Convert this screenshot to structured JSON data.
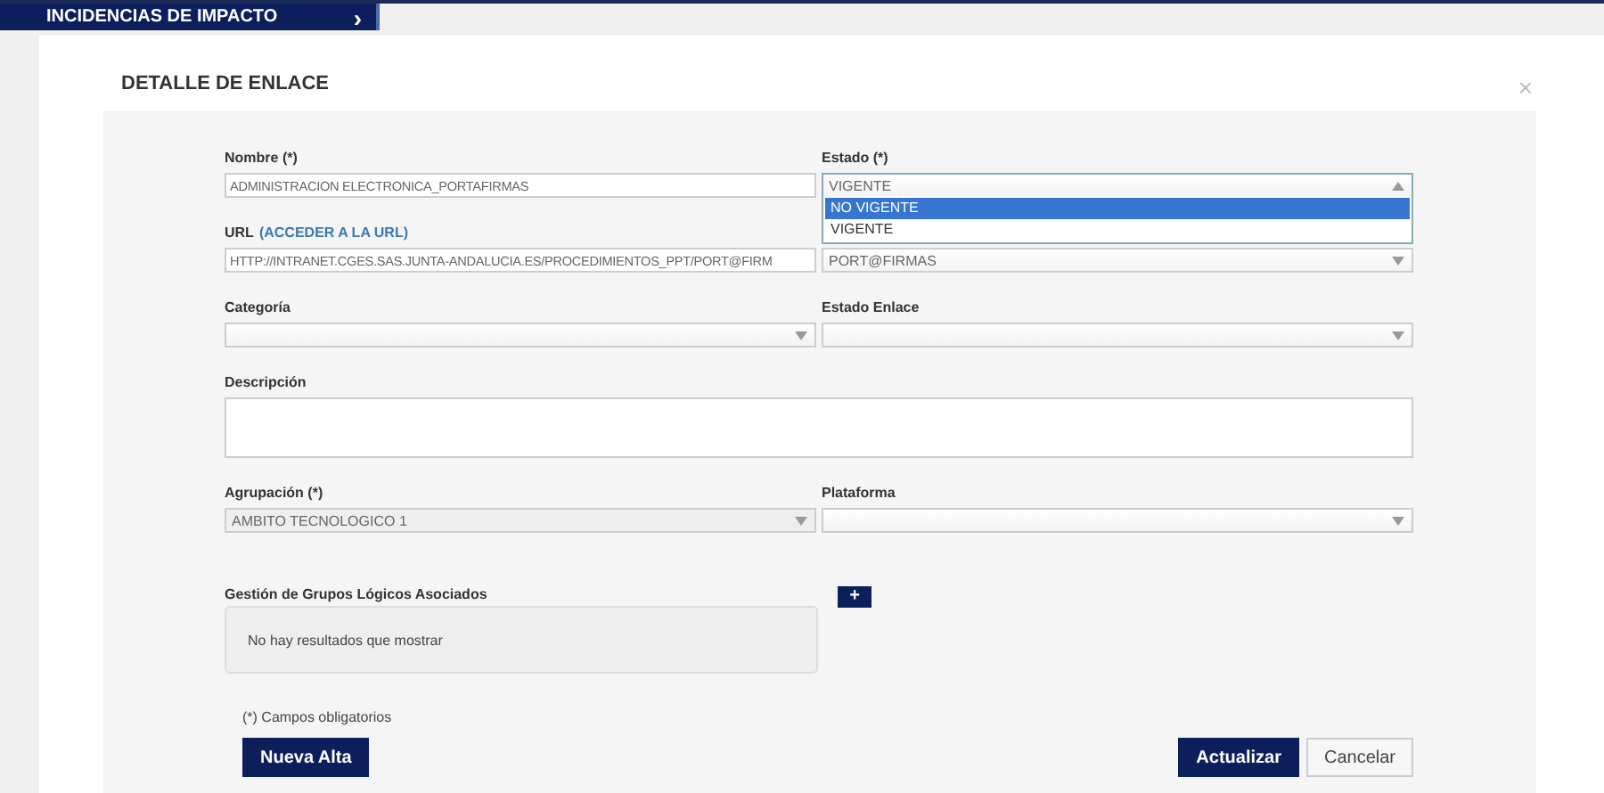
{
  "top_tab": {
    "label": "INCIDENCIAS DE IMPACTO",
    "arrow": "›"
  },
  "dialog": {
    "title": "DETALLE DE ENLACE",
    "close": "×"
  },
  "fields": [
    {
      "kind": "text",
      "label": "Nombre (*)",
      "value": "ADMINISTRACION ELECTRONICA_PORTAFIRMAS",
      "disabled": false
    },
    {
      "kind": "select",
      "label": "Estado (*)",
      "value": "VIGENTE",
      "open": true,
      "disabled": false,
      "options": [
        {
          "label": "NO VIGENTE",
          "highlighted": true
        },
        {
          "label": "VIGENTE",
          "highlighted": false
        }
      ]
    },
    {
      "kind": "text",
      "label": "URL",
      "link": "(ACCEDER A LA URL)",
      "value": "HTTP://INTRANET.CGES.SAS.JUNTA-ANDALUCIA.ES/PROCEDIMIENTOS_PPT/PORT@FIRM",
      "disabled": false
    },
    {
      "kind": "select",
      "value": "PORT@FIRMAS",
      "open": false,
      "disabled": false
    },
    {
      "kind": "select",
      "label": "Categoría",
      "open": false,
      "disabled": false
    },
    {
      "kind": "select",
      "label": "Estado Enlace",
      "open": false,
      "disabled": false
    },
    {
      "kind": "textarea",
      "label": "Descripción",
      "disabled": false
    },
    {
      "kind": "select",
      "label": "Agrupación (*)",
      "value": "AMBITO TECNOLOGICO 1",
      "open": false,
      "disabled": true
    },
    {
      "kind": "select",
      "label": "Plataforma",
      "open": false,
      "disabled": false
    }
  ],
  "groups": {
    "label": "Gestión de Grupos Lógicos Asociados",
    "add_button": "+",
    "empty_message": "No hay resultados que mostrar"
  },
  "required_note": "(*) Campos obligatorios",
  "left_buttons": [
    {
      "label": "Nueva Alta",
      "kind": "primary"
    }
  ],
  "right_buttons": [
    {
      "label": "Actualizar",
      "kind": "primary"
    },
    {
      "label": "Cancelar",
      "kind": "secondary"
    }
  ]
}
